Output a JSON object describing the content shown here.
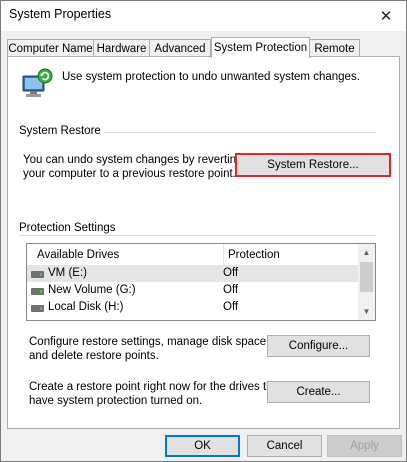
{
  "window": {
    "title": "System Properties",
    "close_glyph": "✕"
  },
  "tabs": [
    {
      "label": "Computer Name",
      "active": false
    },
    {
      "label": "Hardware",
      "active": false
    },
    {
      "label": "Advanced",
      "active": false
    },
    {
      "label": "System Protection",
      "active": true
    },
    {
      "label": "Remote",
      "active": false
    }
  ],
  "intro": {
    "icon": "system-protection-shield-icon",
    "text": "Use system protection to undo unwanted system changes."
  },
  "system_restore": {
    "heading": "System Restore",
    "description_line1": "You can undo system changes by reverting",
    "description_line2": "your computer to a previous restore point.",
    "button_label": "System Restore...",
    "highlight_color": "#e0262a"
  },
  "protection_settings": {
    "heading": "Protection Settings",
    "columns": [
      "Available Drives",
      "Protection"
    ],
    "drives": [
      {
        "name": "VM (E:)",
        "protection": "Off",
        "selected": true
      },
      {
        "name": "New Volume (G:)",
        "protection": "Off",
        "selected": false
      },
      {
        "name": "Local Disk (H:)",
        "protection": "Off",
        "selected": false
      }
    ],
    "configure_text_line1": "Configure restore settings, manage disk space,",
    "configure_text_line2": "and delete restore points.",
    "configure_button": "Configure...",
    "create_text_line1": "Create a restore point right now for the drives that",
    "create_text_line2": "have system protection turned on.",
    "create_button": "Create..."
  },
  "footer": {
    "ok": "OK",
    "cancel": "Cancel",
    "apply": "Apply"
  },
  "colors": {
    "accent": "#0078d7",
    "window_bg": "#f0f0f0",
    "panel_bg": "#ffffff"
  }
}
